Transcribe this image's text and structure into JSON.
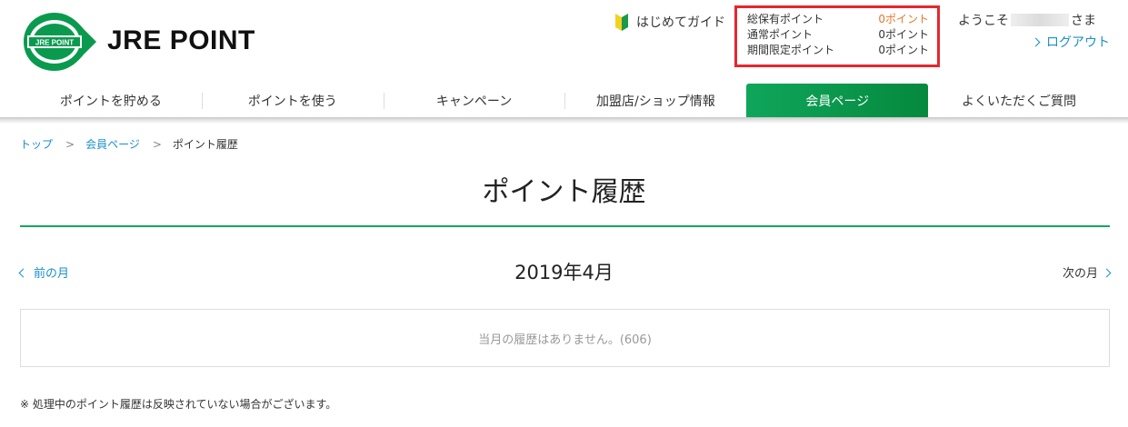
{
  "brand": {
    "name": "JRE POINT",
    "badge": "JRE POINT",
    "color": "#0a9a4e"
  },
  "header": {
    "guide_label": "はじめてガイド",
    "points": [
      {
        "label": "総保有ポイント",
        "value": "0ポイント"
      },
      {
        "label": "通常ポイント",
        "value": "0ポイント"
      },
      {
        "label": "期間限定ポイント",
        "value": "0ポイント"
      }
    ],
    "welcome_prefix": "ようこそ",
    "welcome_suffix": "さま",
    "logout_label": "ログアウト"
  },
  "nav": {
    "items": [
      {
        "label": "ポイントを貯める"
      },
      {
        "label": "ポイントを使う"
      },
      {
        "label": "キャンペーン"
      },
      {
        "label": "加盟店/ショップ情報"
      },
      {
        "label": "会員ページ",
        "active": true
      },
      {
        "label": "よくいただくご質問"
      }
    ]
  },
  "breadcrumb": {
    "items": [
      "トップ",
      "会員ページ"
    ],
    "separator": ">",
    "current": "ポイント履歴"
  },
  "page": {
    "title": "ポイント履歴",
    "prev_month": "前の月",
    "month": "2019年4月",
    "next_month": "次の月",
    "empty_message": "当月の履歴はありません。(606)",
    "note": "※ 処理中のポイント履歴は反映されていない場合がございます。"
  },
  "colors": {
    "accent_green": "#16a562",
    "link_blue": "#1a8fc9",
    "highlight_red": "#e6262e",
    "points_orange": "#e5772d"
  }
}
